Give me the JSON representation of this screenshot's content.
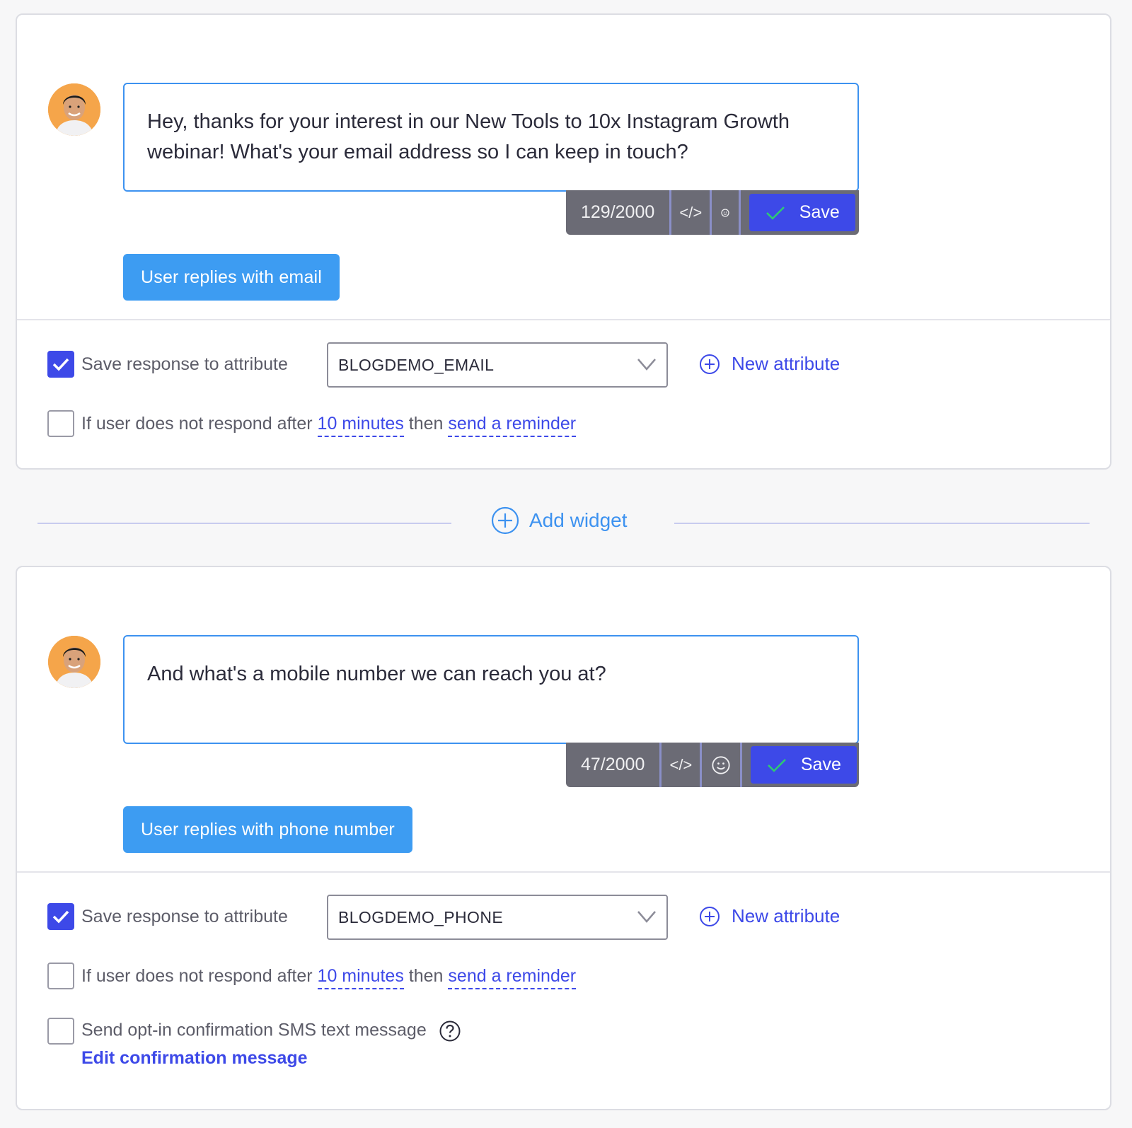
{
  "widgets": [
    {
      "message": "Hey, thanks for your interest in our New Tools to 10x Instagram Growth webinar! What's your email address so I can keep in touch?",
      "char_count": "129/2000",
      "code_icon": "</>",
      "save_label": "Save",
      "reply_button": "User replies with email",
      "save_attr_label": "Save response to attribute",
      "save_attr_checked": true,
      "attribute_value": "BLOGDEMO_EMAIL",
      "new_attribute_label": "New attribute",
      "reminder": {
        "checked": false,
        "prefix": "If user does not respond after",
        "duration": "10 minutes",
        "middle": "then",
        "action": "send a reminder"
      }
    },
    {
      "message": "And what's a mobile number we can reach you at?",
      "char_count": "47/2000",
      "code_icon": "</>",
      "save_label": "Save",
      "reply_button": "User replies with phone number",
      "save_attr_label": "Save response to attribute",
      "save_attr_checked": true,
      "attribute_value": "BLOGDEMO_PHONE",
      "new_attribute_label": "New attribute",
      "reminder": {
        "checked": false,
        "prefix": "If user does not respond after",
        "duration": "10 minutes",
        "middle": "then",
        "action": "send a reminder"
      },
      "optin": {
        "checked": false,
        "label": "Send opt-in confirmation SMS text message",
        "edit_link": "Edit confirmation message"
      }
    }
  ],
  "add_widget_label": "Add widget",
  "colors": {
    "primary": "#3d49e8",
    "reply_button": "#3d9cf2",
    "message_border": "#3d92f0",
    "toolbar": "#6b6b75"
  },
  "icons": {
    "avatar": "avatar",
    "code": "code-icon",
    "emoji": "emoji-icon",
    "check": "check-icon",
    "chevron": "chevron-down-icon",
    "plus_circle": "plus-circle-icon",
    "help": "help-icon"
  }
}
